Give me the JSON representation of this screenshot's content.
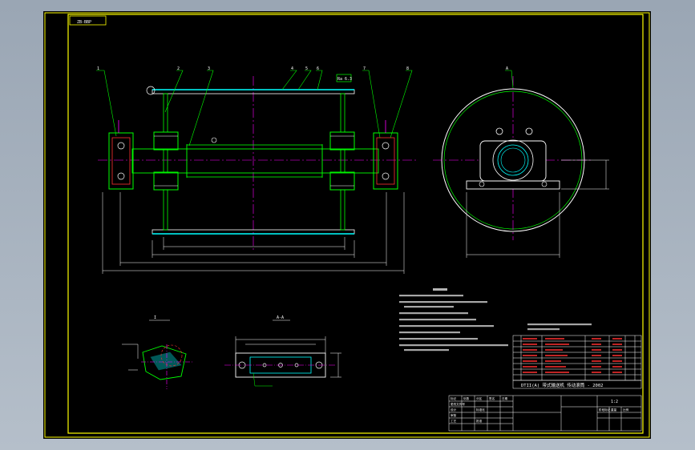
{
  "colors": {
    "background": "#000000",
    "frame": "#ffff00",
    "cyan": "#00ffff",
    "green": "#00ff00",
    "magenta": "#ff00ff",
    "white": "#ffffff",
    "red": "#ff3030",
    "workspace": "#a7b2bf"
  },
  "drawing": {
    "sheet_code": "ZB-BBP",
    "drawing_title": "DTII(A)  带式输送机  传动滚筒 - 2002",
    "scale_label": "1:2",
    "balloon_tags": [
      "1",
      "2",
      "3",
      "4",
      "5",
      "6",
      "7",
      "8"
    ],
    "view_a_label": "A",
    "section_label": "A-A",
    "detail_label": "I",
    "surface_note": "Ra 6.3",
    "title_block_labels": [
      "标记",
      "处数",
      "分区",
      "更改文件号",
      "签名",
      "日期",
      "设计",
      "标准化",
      "审核",
      "工艺",
      "批准",
      "阶段标记",
      "重量",
      "比例"
    ]
  }
}
